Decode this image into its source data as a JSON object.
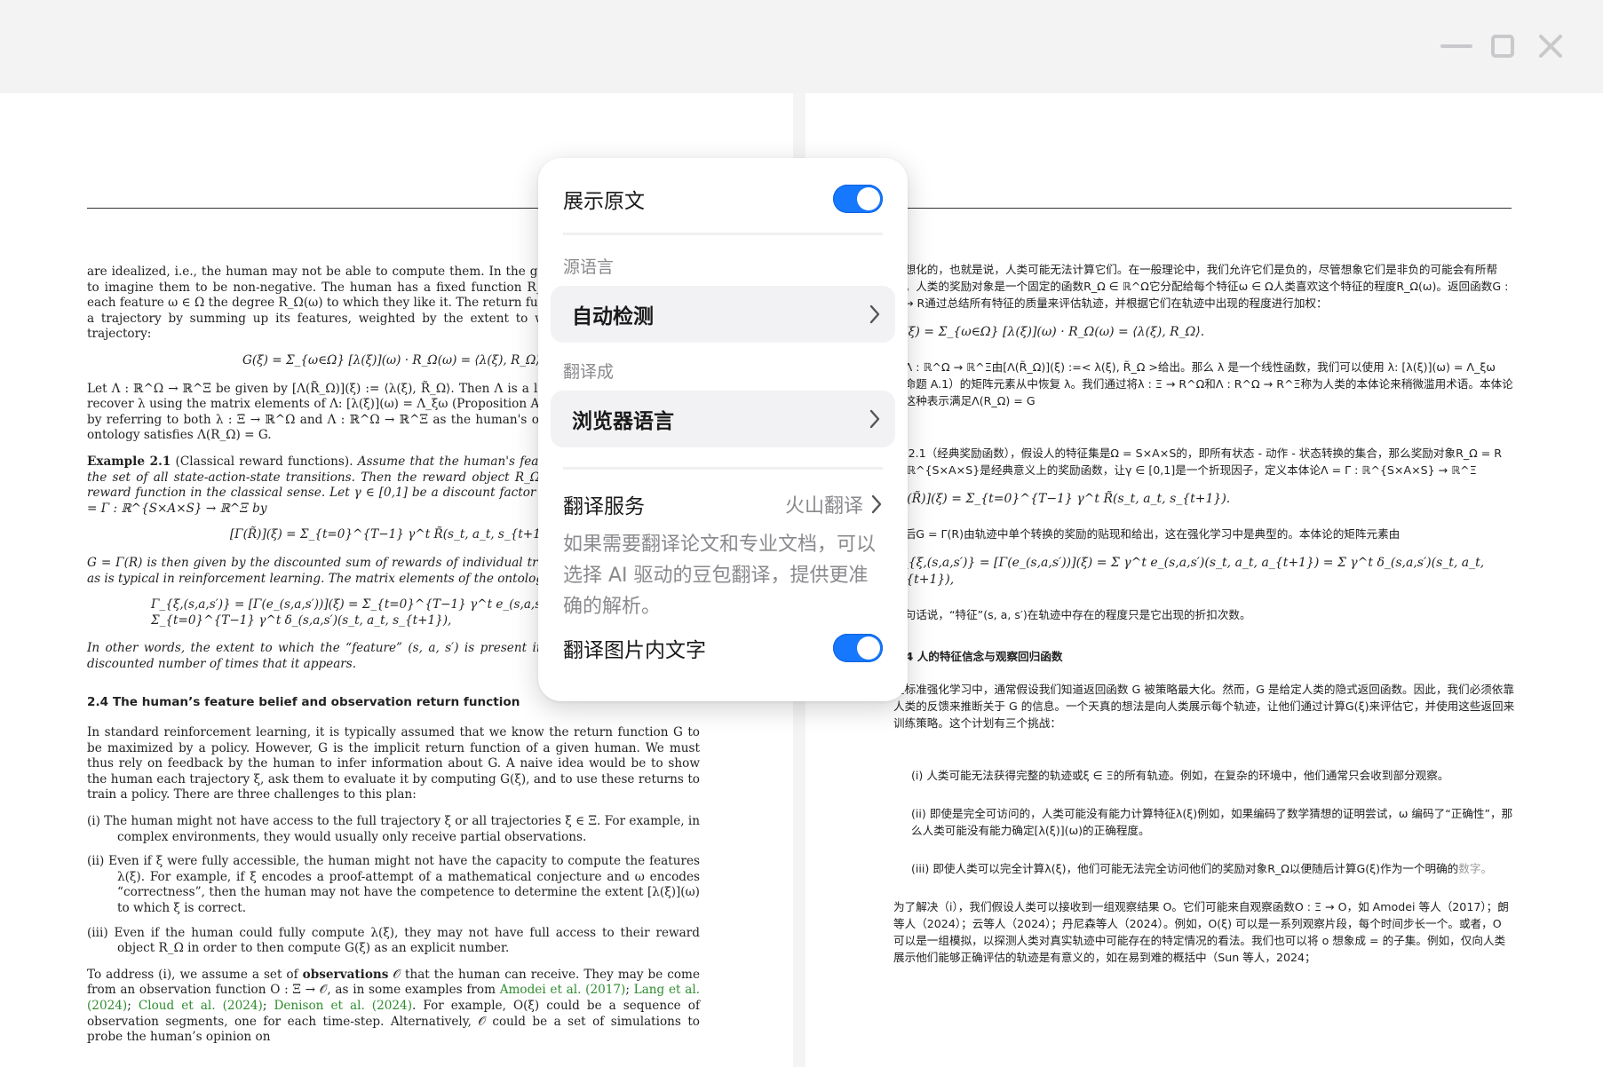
{
  "window": {
    "minimize_icon": "minimize-icon",
    "maximize_icon": "maximize-icon",
    "close_icon": "close-icon"
  },
  "popover": {
    "show_original_label": "展示原文",
    "show_original_on": true,
    "source_language_heading": "源语言",
    "source_language_value": "自动检测",
    "target_language_heading": "翻译成",
    "target_language_value": "浏览器语言",
    "service_label": "翻译服务",
    "service_value": "火山翻译",
    "service_description": "如果需要翻译论文和专业文档，可以选择 AI 驱动的豆包翻译，提供更准确的解析。",
    "translate_images_label": "翻译图片内文字",
    "translate_images_on": true,
    "accent_color": "#1677ff"
  },
  "english": {
    "p1": "are idealized, i.e., the human may not be able to compute them. In the general case, this may help to imagine them to be non-negative. The human has a fixed function R_Ω ∈ ℝ^Ω that assigns to each feature ω ∈ Ω the degree R_Ω(ω) to which they like it. The return function G : Ξ → ℝ evaluates a trajectory by summing up its features, weighted by the extent to which they appear in the trajectory:",
    "eq1": "G(ξ) = Σ_{ω∈Ω} [λ(ξ)](ω) · R_Ω(ω) = ⟨λ(ξ), R_Ω⟩.",
    "p2": "Let Λ : ℝ^Ω → ℝ^Ξ be given by [Λ(R̃_Ω)](ξ) := ⟨λ(ξ), R̃_Ω⟩. Then Λ is a linear function and we can recover λ using the matrix elements of Λ: [λ(ξ)](ω) = Λ_ξω (Proposition A.1). We abuse terminology by referring to both λ : Ξ → ℝ^Ω and Λ : ℝ^Ω → ℝ^Ξ as the human's ontology. The choice of the ontology satisfies Λ(R_Ω) = G.",
    "example_head": "Example 2.1",
    "example_title": "(Classical reward functions).",
    "example_body": "Assume that the human's feature set Ω = S × A × S is the set of all state-action-state transitions. Then the reward object R_Ω = R ∈ ℝ^{S×A×S} is a reward function in the classical sense. Let γ ∈ [0,1] be a discount factor and define the ontology Λ = Γ : ℝ^{S×A×S} → ℝ^Ξ by",
    "eq2": "[Γ(R̃)](ξ) = Σ_{t=0}^{T−1} γ^t R̃(s_t, a_t, s_{t+1}).",
    "p3": "G = Γ(R) is then given by the discounted sum of rewards of individual transitions in the trajectory, as is typical in reinforcement learning. The matrix elements of the ontology Γ are given by",
    "eq3": "Γ_{ξ,(s,a,s′)} = [Γ(e_(s,a,s′))](ξ) = Σ_{t=0}^{T−1} γ^t e_(s,a,s′)(s_t, a_t, a_{t+1}) = Σ_{t=0}^{T−1} γ^t δ_(s,a,s′)(s_t, a_t, s_{t+1}),",
    "p4": "In other words, the extent to which the “feature” (s, a, s′) is present in the trajectory is just its discounted number of times that it appears.",
    "section": "2.4    The human’s feature belief and observation return function",
    "p5": "In standard reinforcement learning, it is typically assumed that we know the return function G to be maximized by a policy. However, G is the implicit return function of a given human. We must thus rely on feedback by the human to infer information about G. A naive idea would be to show the human each trajectory ξ, ask them to evaluate it by computing G(ξ), and to use these returns to train a policy. There are three challenges to this plan:",
    "li1": "(i)  The human might not have access to the full trajectory ξ or all trajectories ξ ∈ Ξ. For example, in complex environments, they would usually only receive partial observations.",
    "li2": "(ii)  Even if ξ were fully accessible, the human might not have the capacity to compute the features λ(ξ). For example, if ξ encodes a proof-attempt of a mathematical conjecture and ω encodes “correctness”, then the human may not have the competence to determine the extent [λ(ξ)](ω) to which ξ is correct.",
    "li3": "(iii)  Even if the human could fully compute λ(ξ), they may not have full access to their reward object R_Ω in order to then compute G(ξ) as an explicit number.",
    "p6_a": "To address (i), we assume a set of ",
    "p6_b": "observations",
    "p6_c": " 𝒪 that the human can receive. They may be come from an observation function O : Ξ → 𝒪, as in some examples from ",
    "cite1": "Amodei et al. (2017)",
    "cite2": "Lang et al. (2024)",
    "cite3": "Cloud et al. (2024)",
    "cite4": "Denison et al. (2024)",
    "p6_d": ". For example, O(ξ) could be a sequence of observation segments, one for each time-step. Alternatively, 𝒪 could be a set of simulations to probe the human’s opinion on"
  },
  "chinese": {
    "p1": "理想化的，也就是说，人类可能无法计算它们。在一般理论中，我们允许它们是负的，尽管想象它们是非负的可能会有所帮助。人类的奖励对象是一个固定的函数R_Ω ∈ ℝ^Ω它分配给每个特征ω ∈ Ω人类喜欢这个特征的程度R_Ω(ω)。返回函数G : Ξ → R通过总结所有特征的质量来评估轨迹，并根据它们在轨迹中出现的程度进行加权：",
    "eq1": "G(ξ) = Σ_{ω∈Ω} [λ(ξ)](ω) · R_Ω(ω) = ⟨λ(ξ), R_Ω⟩.",
    "p2": "让Λ : ℝ^Ω → ℝ^Ξ由[Λ(R̃_Ω)](ξ) :=< λ(ξ), R̃_Ω >给出。那么 λ 是一个线性函数，我们可以使用 λ: [λ(ξ)](ω) = Λ_ξω（命题 A.1）的矩阵元素从中恢复 λ。我们通过将λ : Ξ → R^Ω和Λ : R^Ω → R^Ξ称为人类的本体论来稍微滥用术语。本体论的这种表示满足Λ(R_Ω) = G",
    "p3": "例 2.1（经典奖励函数），假设人的特征集是Ω = S×A×S的，即所有状态 - 动作 - 状态转换的集合，那么奖励对象R_Ω = R ∈ ℝ^{S×A×S}是经典意义上的奖励函数，让γ ∈ [0,1]是一个折现因子，定义本体论Λ = Γ : ℝ^{S×A×S} → ℝ^Ξ",
    "eq2": "[Γ(R̃)](ξ) = Σ_{t=0}^{T−1} γ^t R̃(s_t, a_t, s_{t+1}).",
    "p4": "然后G = Γ(R)由轨迹中单个转换的奖励的贴现和给出，这在强化学习中是典型的。本体论的矩阵元素由",
    "eq3": "Γ_{ξ,(s,a,s′)} = [Γ(e_(s,a,s′))](ξ) = Σ γ^t e_(s,a,s′)(s_t, a_t, a_{t+1}) = Σ γ^t δ_(s,a,s′)(s_t, a_t, s_{t+1}),",
    "p5": "换句话说，“特征”(s, a, s′)在轨迹中存在的程度只是它出现的折扣次数。",
    "section": "2.4 人的特征信念与观察回归函数",
    "p6": "在标准强化学习中，通常假设我们知道返回函数 G 被策略最大化。然而，G 是给定人类的隐式返回函数。因此，我们必须依靠人类的反馈来推断关于 G 的信息。一个天真的想法是向人类展示每个轨迹，让他们通过计算G(ξ)来评估它，并使用这些返回来训练策略。这个计划有三个挑战：",
    "li1": "(i)  人类可能无法获得完整的轨迹或ξ ∈ Ξ的所有轨迹。例如，在复杂的环境中，他们通常只会收到部分观察。",
    "li2": "(ii)  即使是完全可访问的，人类可能没有能力计算特征λ(ξ)例如，如果编码了数学猜想的证明尝试，ω 编码了“正确性”，那么人类可能没有能力确定[λ(ξ)](ω)的正确程度。",
    "li3a": "(iii)  即使人类可以完全计算λ(ξ)，他们可能无法完全访问他们的奖励对象R_Ω以便随后计算G(ξ)作为一个明确的",
    "li3b": "数字。",
    "p7": "为了解决（i），我们假设人类可以接收到一组观察结果 O。它们可能来自观察函数O : Ξ → O，如 Amodei 等人（2017）；朗等人（2024）；云等人（2024）；丹尼森等人（2024）。例如，O(ξ) 可以是一系列观察片段，每个时间步长一个。或者，O 可以是一组模拟，以探测人类对真实轨迹中可能存在的特定情况的看法。我们也可以将 o 想象成 = 的子集。例如，仅向人类展示他们能够正确评估的轨迹是有意义的，如在易到难的概括中（Sun 等人，2024；"
  }
}
